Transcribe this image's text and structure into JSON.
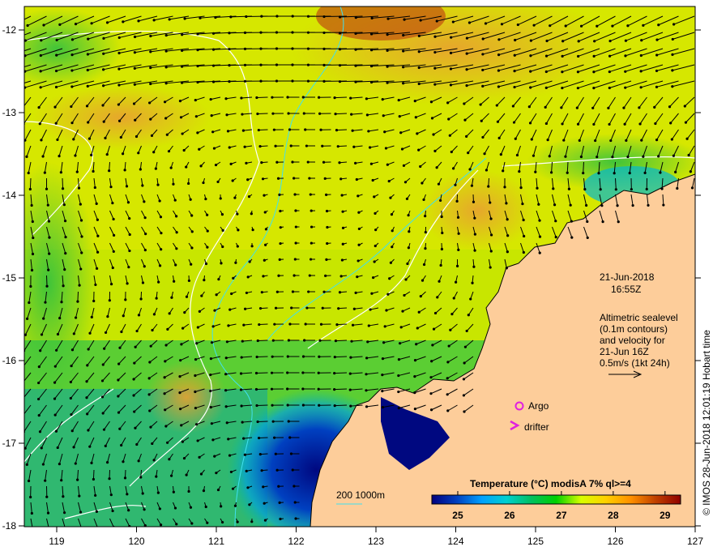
{
  "map": {
    "lon_ticks": [
      "119",
      "120",
      "121",
      "122",
      "123",
      "124",
      "125",
      "126",
      "127"
    ],
    "lat_ticks": [
      "-12",
      "-13",
      "-14",
      "-15",
      "-16",
      "-17",
      "-18"
    ],
    "lon_range": [
      118.6,
      127
    ],
    "lat_range": [
      -18.1,
      -11.95
    ]
  },
  "annotation": {
    "date": "21-Jun-2018",
    "time": "16:55Z",
    "desc_lines": [
      "Altimetric sealevel",
      "(0.1m contours)",
      "and velocity for",
      "21-Jun 16Z",
      "0.5m/s (1kt 24h)"
    ]
  },
  "legend": {
    "argo": "Argo",
    "drifter": "drifter",
    "depth_labels": "200  1000m",
    "argo_color": "#e020e0",
    "depth_200_color": "#40e0f0"
  },
  "colorbar": {
    "title": "Temperature (°C) modisA 7% ql>=4",
    "ticks": [
      "25",
      "26",
      "27",
      "28",
      "29"
    ],
    "range": [
      24.5,
      29.3
    ],
    "colors": [
      "#00007f",
      "#0040c0",
      "#00a0ff",
      "#00d0d0",
      "#00c060",
      "#00d000",
      "#d8ff00",
      "#ffd000",
      "#ff9000",
      "#c04000",
      "#900000"
    ]
  },
  "credit": "© IMOS 28-Jun-2018 12:01:19 Hobart time",
  "colors": {
    "land": "#fdcd9a",
    "sea_base": "#b8e000"
  }
}
